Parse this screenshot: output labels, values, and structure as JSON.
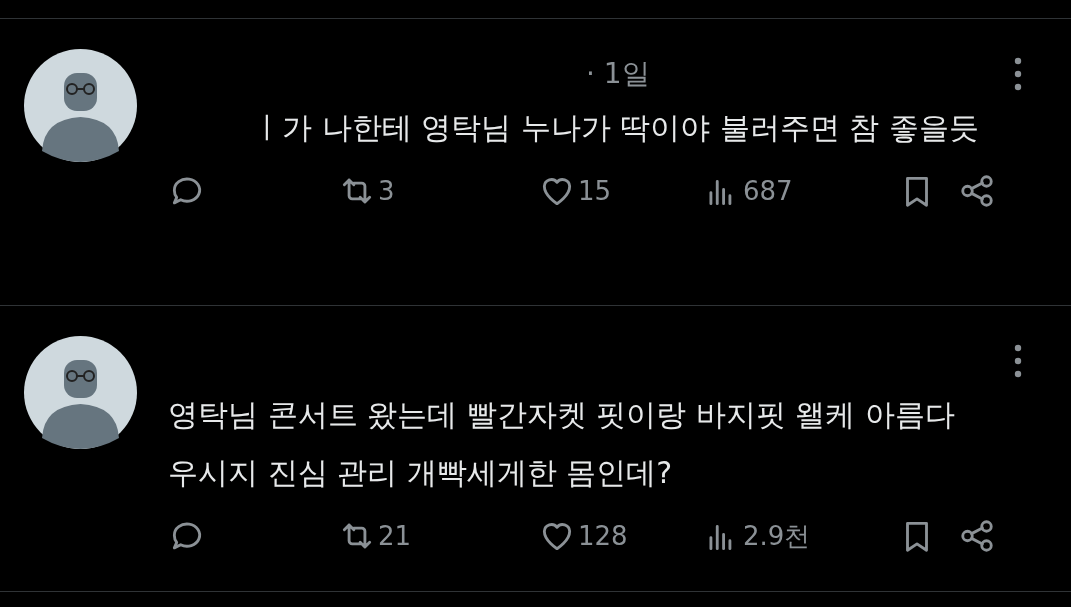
{
  "posts": [
    {
      "time": "· 1일",
      "text": "ㅣ가 나한테 영탁님 누나가 딱이야 불러주면 참 좋을듯",
      "text_indent": true,
      "reposts": "3",
      "likes": "15",
      "views": "687"
    },
    {
      "text": "영탁님 콘서트 왔는데 빨간자켓 핏이랑 바지핏 왤케 아름다우시지 진심 관리 개빡세게한 몸인데?",
      "text_indent": false,
      "reposts": "21",
      "likes": "128",
      "views": "2.9천"
    }
  ]
}
